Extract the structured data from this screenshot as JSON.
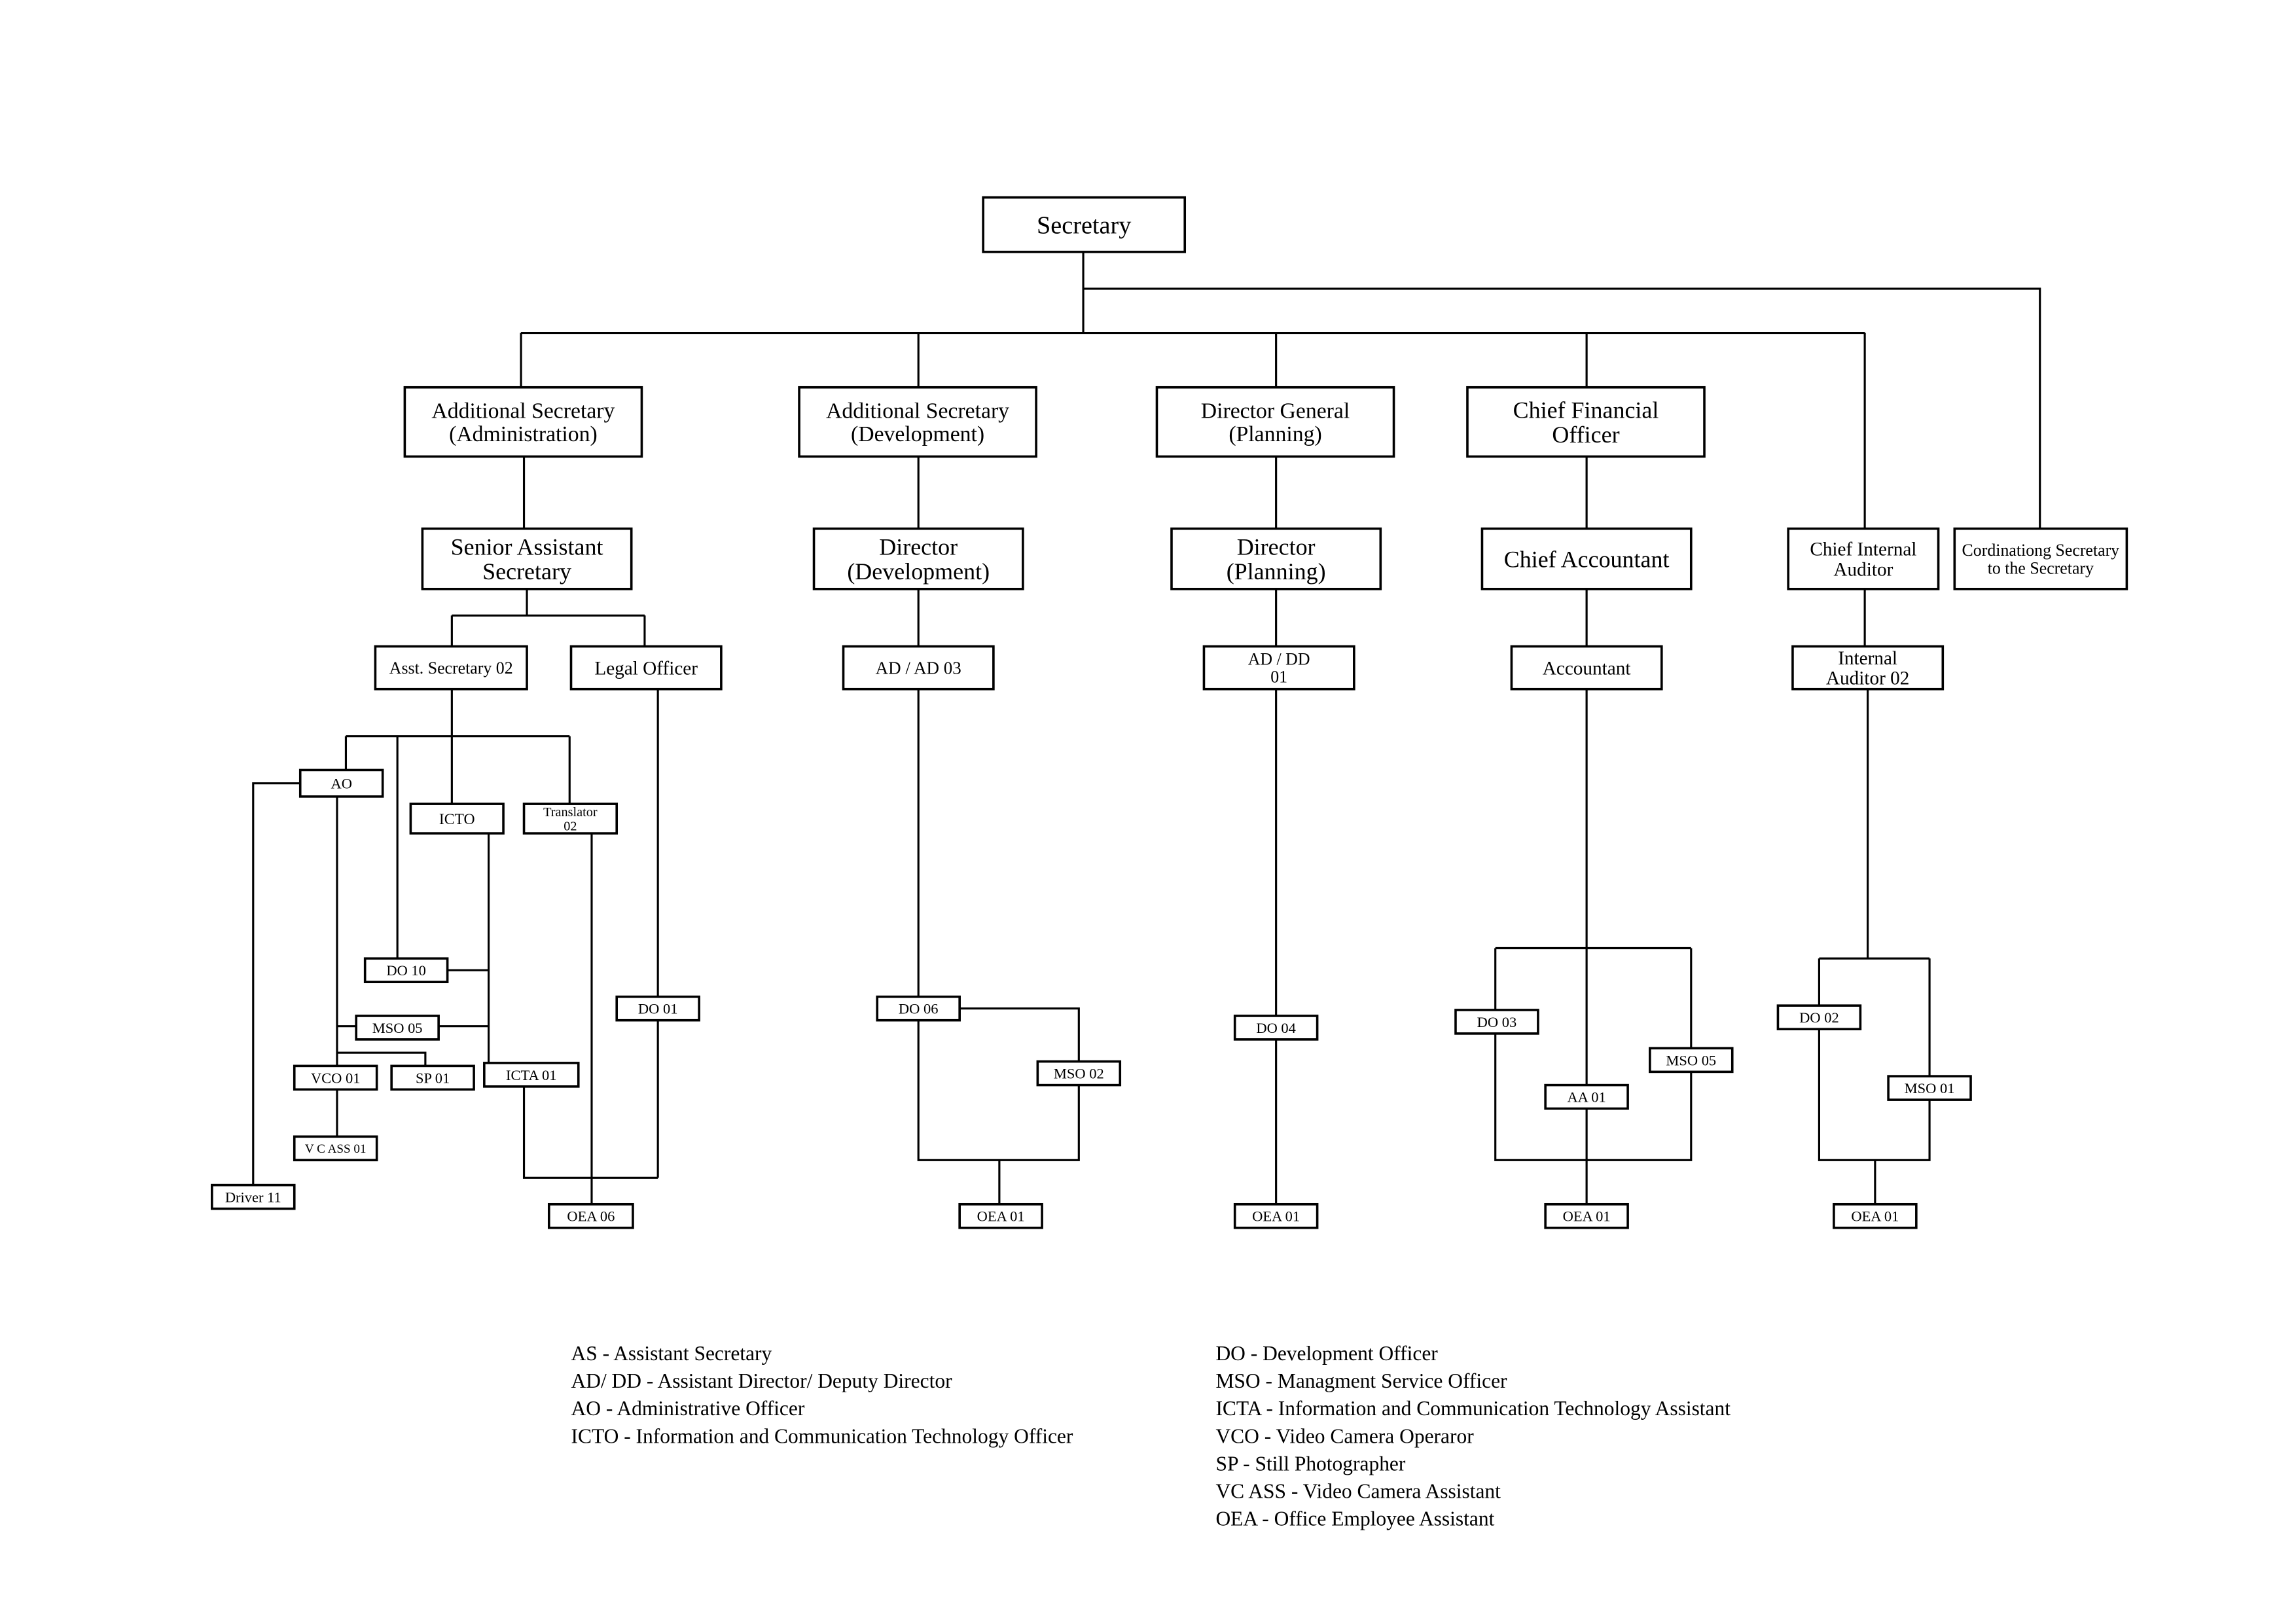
{
  "org_chart": {
    "nodes": {
      "secretary": [
        "Secretary"
      ],
      "as_admin": [
        "Additional Secretary",
        "(Administration)"
      ],
      "as_dev": [
        "Additional Secretary",
        "(Development)"
      ],
      "dg_plan": [
        "Director General",
        "(Planning)"
      ],
      "cfo": [
        "Chief Financial",
        "Officer"
      ],
      "sas": [
        "Senior Assistant",
        "Secretary"
      ],
      "dir_dev": [
        "Director",
        "(Development)"
      ],
      "dir_plan": [
        "Director",
        "(Planning)"
      ],
      "chief_acc": [
        "Chief Accountant"
      ],
      "cia": [
        "Chief Internal",
        "Auditor"
      ],
      "coord": [
        "Cordinationg Secretary",
        "to the Secretary"
      ],
      "asst_sec": [
        "Asst. Secretary 02"
      ],
      "legal": [
        "Legal Officer"
      ],
      "ad03": [
        "AD / AD 03"
      ],
      "addd": [
        "AD / DD",
        "01"
      ],
      "accountant": [
        "Accountant"
      ],
      "ia02": [
        "Internal",
        "Auditor 02"
      ],
      "ao": [
        "AO"
      ],
      "icto": [
        "ICTO"
      ],
      "translator": [
        "Translator",
        "02"
      ],
      "do10": [
        "DO 10"
      ],
      "do01": [
        "DO 01"
      ],
      "mso05": [
        "MSO 05"
      ],
      "vco01": [
        "VCO 01"
      ],
      "sp01": [
        "SP 01"
      ],
      "icta01": [
        "ICTA 01"
      ],
      "vcass": [
        "V C ASS 01"
      ],
      "driver": [
        "Driver 11"
      ],
      "oea06": [
        "OEA 06"
      ],
      "do06": [
        "DO 06"
      ],
      "mso02": [
        "MSO 02"
      ],
      "oea_dev": [
        "OEA 01"
      ],
      "do04": [
        "DO 04"
      ],
      "oea_plan": [
        "OEA 01"
      ],
      "do03": [
        "DO 03"
      ],
      "mso05b": [
        "MSO 05"
      ],
      "aa01": [
        "AA 01"
      ],
      "oea_fin": [
        "OEA 01"
      ],
      "do02": [
        "DO 02"
      ],
      "mso01": [
        "MSO 01"
      ],
      "oea_ia": [
        "OEA 01"
      ]
    }
  },
  "legend": {
    "left": [
      "AS - Assistant Secretary",
      "AD/ DD - Assistant Director/ Deputy Director",
      "AO - Administrative Officer",
      "ICTO - Information and Communication Technology Officer"
    ],
    "right": [
      "DO - Development Officer",
      "MSO - Managment Service Officer",
      "ICTA - Information and Communication Technology Assistant",
      "VCO - Video Camera Operaror",
      "SP - Still Photographer",
      "VC ASS - Video Camera Assistant",
      "OEA - Office Employee Assistant"
    ]
  }
}
